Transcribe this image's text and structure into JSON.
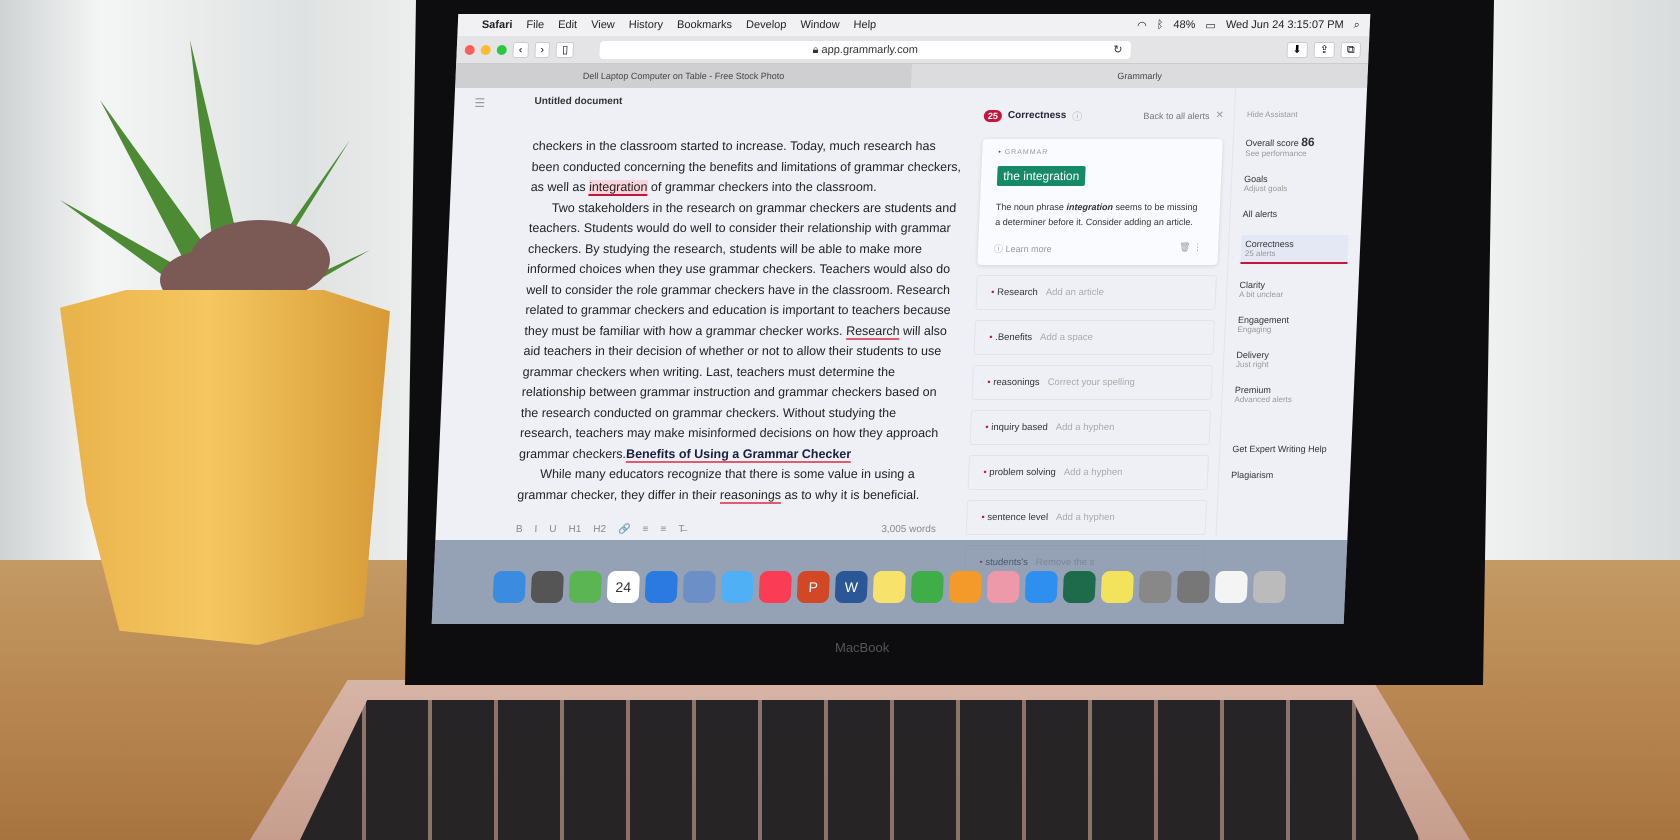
{
  "menubar": {
    "apple": "",
    "app": "Safari",
    "items": [
      "File",
      "Edit",
      "View",
      "History",
      "Bookmarks",
      "Develop",
      "Window",
      "Help"
    ],
    "battery": "48%",
    "datetime": "Wed Jun 24  3:15:07 PM"
  },
  "browser": {
    "url": "app.grammarly.com",
    "tabs": [
      "Dell Laptop Computer on Table - Free Stock Photo",
      "Grammarly"
    ]
  },
  "document": {
    "title": "Untitled document",
    "word_count": "3,005 words",
    "p1a": "checkers in the classroom started to increase. Today, much research has been conducted concerning the benefits and limitations of grammar checkers, as well as ",
    "p1hl": "integration",
    "p1b": " of grammar checkers into the classroom.",
    "p2a": "Two stakeholders in the research on grammar checkers are students and teachers. Students would do well to consider their relationship with grammar checkers. By studying the research, students will be able to make more informed choices when they use grammar checkers. Teachers would also do well to consider the role grammar checkers have in the classroom. Research related to grammar checkers and education is important to teachers because they must be familiar with how a grammar checker works. ",
    "p2ul": "Research",
    "p2b": " will also aid teachers in their decision of whether or not to allow their students to use grammar checkers when writing. Last, teachers must determine the relationship between grammar instruction and grammar checkers based on the research conducted on grammar checkers. Without studying the research, teachers may make misinformed decisions on how they approach grammar checkers.",
    "heading": "Benefits of Using a Grammar Checker",
    "p3a": "While many educators recognize that there is some value in using a grammar checker, they differ in their ",
    "p3ul": "reasonings",
    "p3b": " as to why it is beneficial.",
    "tools": [
      "B",
      "I",
      "U",
      "H1",
      "H2",
      "🔗",
      "≡",
      "≡",
      "T̶"
    ]
  },
  "assistant": {
    "count": "25",
    "category": "Correctness",
    "back": "Back to all alerts",
    "close": "✕",
    "card": {
      "tag": "GRAMMAR",
      "suggestion": "the integration",
      "msg_a": "The noun phrase ",
      "msg_b": "integration",
      "msg_c": " seems to be missing a determiner before it. Consider adding an article.",
      "learn": "Learn more"
    },
    "alerts": [
      {
        "word": "Research",
        "hint": "Add an article"
      },
      {
        "word": ".Benefits",
        "hint": "Add a space"
      },
      {
        "word": "reasonings",
        "hint": "Correct your spelling"
      },
      {
        "word": "inquiry based",
        "hint": "Add a hyphen"
      },
      {
        "word": "problem solving",
        "hint": "Add a hyphen"
      },
      {
        "word": "sentence level",
        "hint": "Add a hyphen"
      },
      {
        "word": "students's",
        "hint": "Remove the s"
      }
    ]
  },
  "sidebar": {
    "hide": "Hide Assistant",
    "score_label": "Overall score",
    "score": "86",
    "score_sub": "See performance",
    "goals": "Goals",
    "goals_sub": "Adjust goals",
    "all": "All alerts",
    "cats": [
      {
        "name": "Correctness",
        "sub": "25 alerts"
      },
      {
        "name": "Clarity",
        "sub": "A bit unclear"
      },
      {
        "name": "Engagement",
        "sub": "Engaging"
      },
      {
        "name": "Delivery",
        "sub": "Just right"
      },
      {
        "name": "Premium",
        "sub": "Advanced alerts"
      }
    ],
    "expert": "Get Expert Writing Help",
    "plagiarism": "Plagiarism"
  },
  "dock": [
    {
      "name": "Finder",
      "color": "#3b8be0"
    },
    {
      "name": "Launchpad",
      "color": "#555"
    },
    {
      "name": "Maps",
      "color": "#5ab552"
    },
    {
      "name": "Calendar",
      "color": "#fff",
      "label": "24"
    },
    {
      "name": "Keynote",
      "color": "#2a7ae2"
    },
    {
      "name": "Preview",
      "color": "#6c8fc8"
    },
    {
      "name": "Messages",
      "color": "#4fb0f5"
    },
    {
      "name": "Music",
      "color": "#fa3c55"
    },
    {
      "name": "PowerPoint",
      "color": "#d24726",
      "label": "P"
    },
    {
      "name": "Word",
      "color": "#2b5797",
      "label": "W"
    },
    {
      "name": "Notes",
      "color": "#f7e26b"
    },
    {
      "name": "Numbers",
      "color": "#3fae49"
    },
    {
      "name": "Pages",
      "color": "#f39a2b"
    },
    {
      "name": "Photos",
      "color": "#e9a"
    },
    {
      "name": "Safari",
      "color": "#2f8ff0"
    },
    {
      "name": "Screens",
      "color": "#1d6b4a"
    },
    {
      "name": "Stickies",
      "color": "#f2e25c"
    },
    {
      "name": "Image Capture",
      "color": "#888"
    },
    {
      "name": "System Preferences",
      "color": "#777"
    },
    {
      "name": "News",
      "color": "#f4f4f4"
    },
    {
      "name": "Trash",
      "color": "#bbb"
    }
  ],
  "laptop": {
    "brand": "MacBook"
  }
}
